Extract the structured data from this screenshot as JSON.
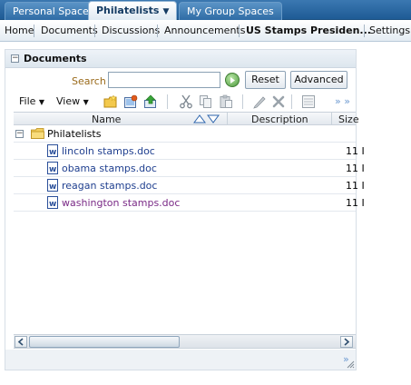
{
  "top_tabs": [
    {
      "label": "Personal Space",
      "active": false
    },
    {
      "label": "Philatelists",
      "active": true
    },
    {
      "label": "My Group Spaces",
      "active": false
    }
  ],
  "subnav": [
    {
      "label": "Home"
    },
    {
      "label": "Documents"
    },
    {
      "label": "Discussions"
    },
    {
      "label": "Announcements"
    },
    {
      "label": "US Stamps Presiden..."
    },
    {
      "label": "Settings"
    }
  ],
  "panel": {
    "title": "Documents",
    "search_label": "Search",
    "search_value": "",
    "reset_label": "Reset",
    "advanced_label": "Advanced"
  },
  "toolbar": {
    "file_label": "File",
    "view_label": "View",
    "icons": [
      "new-folder-icon",
      "upload-icon",
      "move-up-icon",
      "cut-icon",
      "copy-icon",
      "paste-icon",
      "edit-icon",
      "delete-icon",
      "properties-icon"
    ],
    "more": "» »"
  },
  "table": {
    "columns": [
      "Name",
      "Description",
      "Size"
    ],
    "folder": {
      "name": "Philatelists"
    },
    "rows": [
      {
        "name": "lincoln stamps.doc",
        "size": "11 I",
        "visited": false
      },
      {
        "name": "obama stamps.doc",
        "size": "11 I",
        "visited": false
      },
      {
        "name": "reagan stamps.doc",
        "size": "11 I",
        "visited": false
      },
      {
        "name": "washington stamps.doc",
        "size": "11 I",
        "visited": true
      }
    ]
  },
  "footer": {
    "more": "»"
  },
  "colors": {
    "tab_bar": "#1e5b95",
    "link": "#1f3f8f",
    "visited_link": "#7a2a86",
    "search_label": "#9a6a1a"
  }
}
